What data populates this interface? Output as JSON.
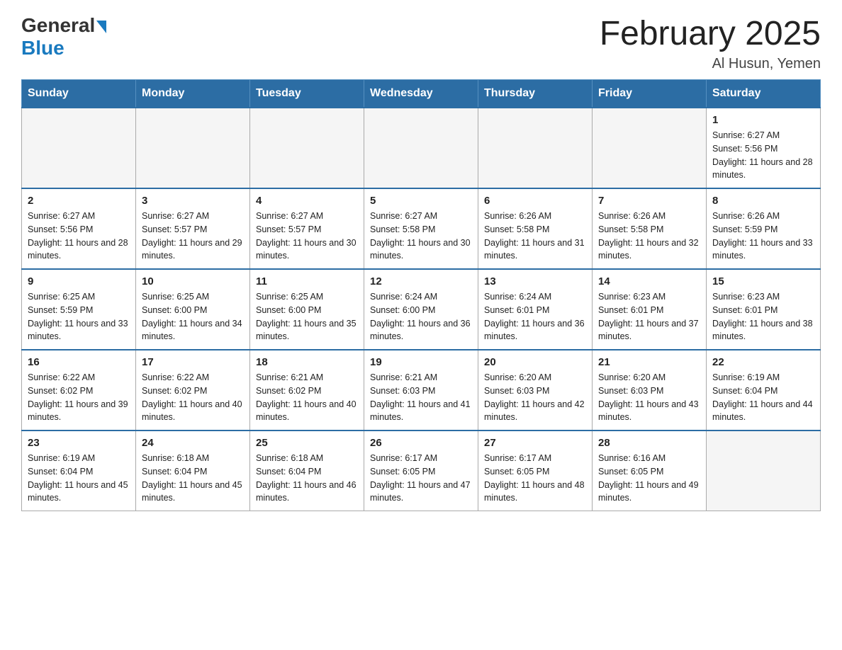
{
  "header": {
    "logo_general": "General",
    "logo_blue": "Blue",
    "month_title": "February 2025",
    "location": "Al Husun, Yemen"
  },
  "days_of_week": [
    "Sunday",
    "Monday",
    "Tuesday",
    "Wednesday",
    "Thursday",
    "Friday",
    "Saturday"
  ],
  "weeks": [
    [
      {
        "day": "",
        "info": ""
      },
      {
        "day": "",
        "info": ""
      },
      {
        "day": "",
        "info": ""
      },
      {
        "day": "",
        "info": ""
      },
      {
        "day": "",
        "info": ""
      },
      {
        "day": "",
        "info": ""
      },
      {
        "day": "1",
        "info": "Sunrise: 6:27 AM\nSunset: 5:56 PM\nDaylight: 11 hours and 28 minutes."
      }
    ],
    [
      {
        "day": "2",
        "info": "Sunrise: 6:27 AM\nSunset: 5:56 PM\nDaylight: 11 hours and 28 minutes."
      },
      {
        "day": "3",
        "info": "Sunrise: 6:27 AM\nSunset: 5:57 PM\nDaylight: 11 hours and 29 minutes."
      },
      {
        "day": "4",
        "info": "Sunrise: 6:27 AM\nSunset: 5:57 PM\nDaylight: 11 hours and 30 minutes."
      },
      {
        "day": "5",
        "info": "Sunrise: 6:27 AM\nSunset: 5:58 PM\nDaylight: 11 hours and 30 minutes."
      },
      {
        "day": "6",
        "info": "Sunrise: 6:26 AM\nSunset: 5:58 PM\nDaylight: 11 hours and 31 minutes."
      },
      {
        "day": "7",
        "info": "Sunrise: 6:26 AM\nSunset: 5:58 PM\nDaylight: 11 hours and 32 minutes."
      },
      {
        "day": "8",
        "info": "Sunrise: 6:26 AM\nSunset: 5:59 PM\nDaylight: 11 hours and 33 minutes."
      }
    ],
    [
      {
        "day": "9",
        "info": "Sunrise: 6:25 AM\nSunset: 5:59 PM\nDaylight: 11 hours and 33 minutes."
      },
      {
        "day": "10",
        "info": "Sunrise: 6:25 AM\nSunset: 6:00 PM\nDaylight: 11 hours and 34 minutes."
      },
      {
        "day": "11",
        "info": "Sunrise: 6:25 AM\nSunset: 6:00 PM\nDaylight: 11 hours and 35 minutes."
      },
      {
        "day": "12",
        "info": "Sunrise: 6:24 AM\nSunset: 6:00 PM\nDaylight: 11 hours and 36 minutes."
      },
      {
        "day": "13",
        "info": "Sunrise: 6:24 AM\nSunset: 6:01 PM\nDaylight: 11 hours and 36 minutes."
      },
      {
        "day": "14",
        "info": "Sunrise: 6:23 AM\nSunset: 6:01 PM\nDaylight: 11 hours and 37 minutes."
      },
      {
        "day": "15",
        "info": "Sunrise: 6:23 AM\nSunset: 6:01 PM\nDaylight: 11 hours and 38 minutes."
      }
    ],
    [
      {
        "day": "16",
        "info": "Sunrise: 6:22 AM\nSunset: 6:02 PM\nDaylight: 11 hours and 39 minutes."
      },
      {
        "day": "17",
        "info": "Sunrise: 6:22 AM\nSunset: 6:02 PM\nDaylight: 11 hours and 40 minutes."
      },
      {
        "day": "18",
        "info": "Sunrise: 6:21 AM\nSunset: 6:02 PM\nDaylight: 11 hours and 40 minutes."
      },
      {
        "day": "19",
        "info": "Sunrise: 6:21 AM\nSunset: 6:03 PM\nDaylight: 11 hours and 41 minutes."
      },
      {
        "day": "20",
        "info": "Sunrise: 6:20 AM\nSunset: 6:03 PM\nDaylight: 11 hours and 42 minutes."
      },
      {
        "day": "21",
        "info": "Sunrise: 6:20 AM\nSunset: 6:03 PM\nDaylight: 11 hours and 43 minutes."
      },
      {
        "day": "22",
        "info": "Sunrise: 6:19 AM\nSunset: 6:04 PM\nDaylight: 11 hours and 44 minutes."
      }
    ],
    [
      {
        "day": "23",
        "info": "Sunrise: 6:19 AM\nSunset: 6:04 PM\nDaylight: 11 hours and 45 minutes."
      },
      {
        "day": "24",
        "info": "Sunrise: 6:18 AM\nSunset: 6:04 PM\nDaylight: 11 hours and 45 minutes."
      },
      {
        "day": "25",
        "info": "Sunrise: 6:18 AM\nSunset: 6:04 PM\nDaylight: 11 hours and 46 minutes."
      },
      {
        "day": "26",
        "info": "Sunrise: 6:17 AM\nSunset: 6:05 PM\nDaylight: 11 hours and 47 minutes."
      },
      {
        "day": "27",
        "info": "Sunrise: 6:17 AM\nSunset: 6:05 PM\nDaylight: 11 hours and 48 minutes."
      },
      {
        "day": "28",
        "info": "Sunrise: 6:16 AM\nSunset: 6:05 PM\nDaylight: 11 hours and 49 minutes."
      },
      {
        "day": "",
        "info": ""
      }
    ]
  ]
}
